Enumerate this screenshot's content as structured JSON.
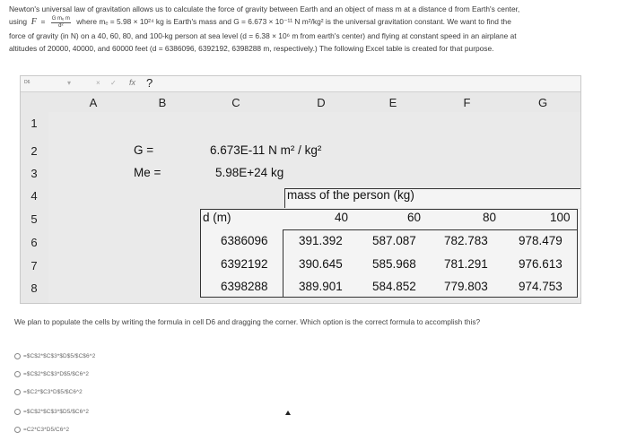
{
  "intro": {
    "line1": "Newton's universal law of gravitation allows us to calculate the force of gravity between Earth and an object of mass m at a distance d from Earth's center,",
    "line2_prefix": "using",
    "formula_lhs": "F",
    "formula_eq": "=",
    "formula_num": "G mₑ m",
    "formula_den": "d²",
    "line2_suffix": "where mₑ = 5.98 × 10²⁴ kg is Earth's mass and G = 6.673 × 10⁻¹¹ N m²/kg² is the universal gravitation constant. We want to find the",
    "line3": "force of gravity (in N) on a 40, 60, 80, and 100-kg person at sea level (d = 6.38 × 10⁶ m from earth's center) and flying at constant speed in an airplane at",
    "line4": "altitudes of 20000, 40000, and 60000 feet (d = 6386096, 6392192, 6398288 m, respectively.) The following Excel table is created for that purpose."
  },
  "toolbar": {
    "cell_ref": "D6",
    "cancel_glyph": "×",
    "confirm_glyph": "✓",
    "fx_label": "fx",
    "question_mark": "?"
  },
  "columns": [
    "A",
    "B",
    "C",
    "D",
    "E",
    "F",
    "G"
  ],
  "rows": [
    "1",
    "2",
    "3",
    "4",
    "5",
    "6",
    "7",
    "8"
  ],
  "cells": {
    "b2": "G =",
    "c2_value": "6.673E-11",
    "c2_unit": "N m² / kg²",
    "b3": "Me =",
    "c3_value": "5.98E+24",
    "c3_unit": "kg",
    "d4": "mass of the person (kg)",
    "c5": "d (m)",
    "d5": "40",
    "e5": "60",
    "f5": "80",
    "g5": "100"
  },
  "data_rows": [
    {
      "d": "6386096",
      "values": [
        "391.392",
        "587.087",
        "782.783",
        "978.479"
      ]
    },
    {
      "d": "6392192",
      "values": [
        "390.645",
        "585.968",
        "781.291",
        "976.613"
      ]
    },
    {
      "d": "6398288",
      "values": [
        "389.901",
        "584.852",
        "779.803",
        "974.753"
      ]
    }
  ],
  "question": "We plan to populate the cells by writing the formula in cell D6 and dragging the corner. Which option is the correct formula to accomplish this?",
  "options": [
    "=$C$2*$C$3*$D$5/$C$6^2",
    "=$C$2*$C$3*D$5/$C6^2",
    "=$C2*$C3*D$5/$C6^2",
    "=$C$2*$C$3*$D5/$C6^2",
    "=C2*C3*D5/C6^2"
  ]
}
